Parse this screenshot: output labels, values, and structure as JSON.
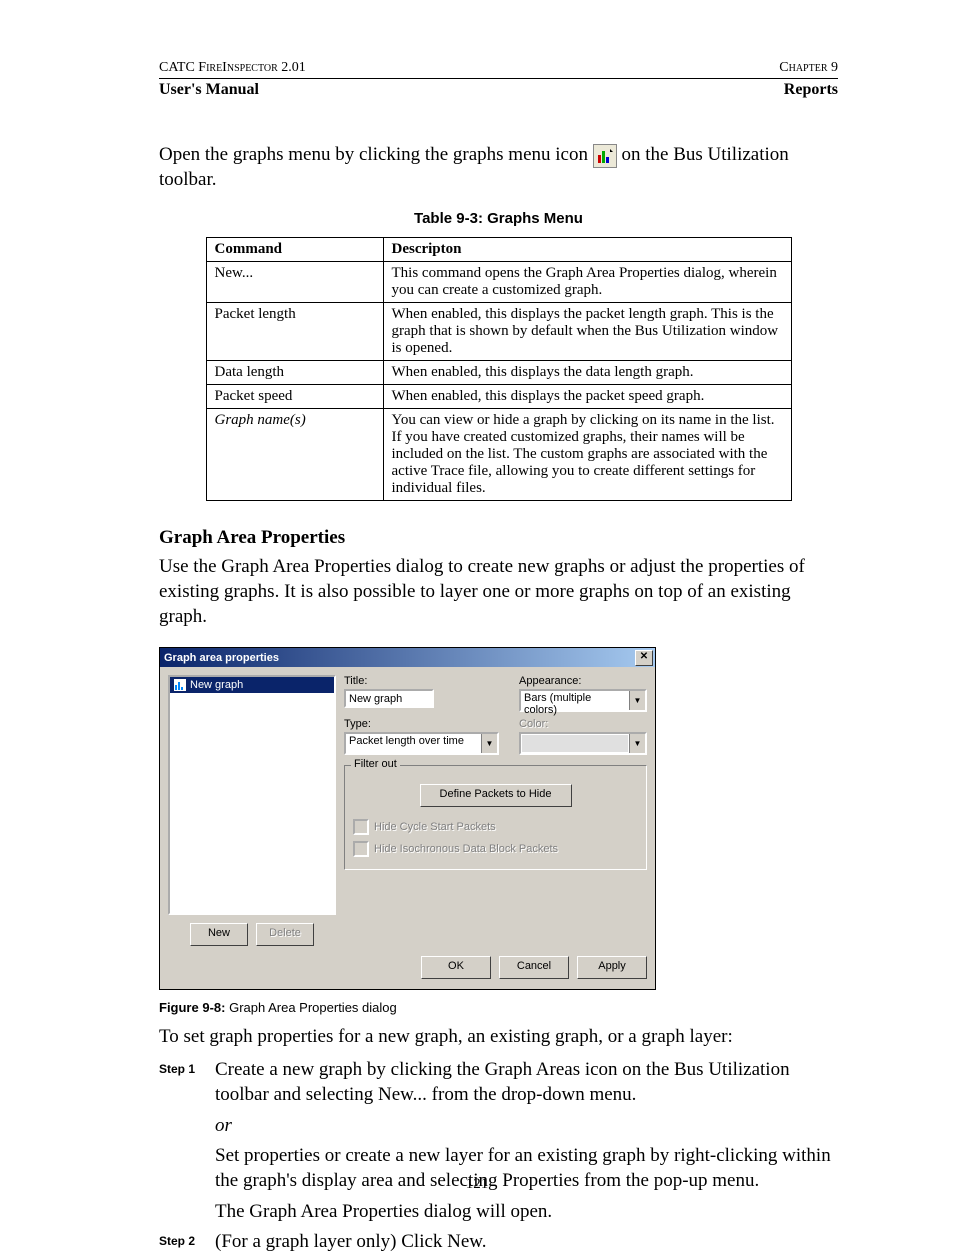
{
  "header": {
    "product": "CATC FireInspector 2.01",
    "chapter": "Chapter 9",
    "manual": "User's Manual",
    "section": "Reports"
  },
  "intro_a": "Open the graphs menu by clicking the graphs menu icon ",
  "intro_b": " on the Bus Utilization toolbar.",
  "table_caption": "Table 9-3: Graphs Menu",
  "table": {
    "headers": [
      "Command",
      "Descripton"
    ],
    "rows": [
      {
        "cmd": "New...",
        "desc": "This command opens the Graph Area Properties dialog, wherein you can create a customized graph."
      },
      {
        "cmd": "Packet length",
        "desc": "When enabled, this displays the packet length graph. This is the graph that is shown by default when the Bus Utilization window is opened."
      },
      {
        "cmd": "Data length",
        "desc": "When enabled, this displays the data length graph."
      },
      {
        "cmd": "Packet speed",
        "desc": "When enabled, this displays the packet speed graph."
      },
      {
        "cmd": "Graph name(s)",
        "italic": true,
        "desc": "You can view or hide a graph by clicking on its name in the list. If you have created customized graphs, their names will be included on the list. The custom graphs are associated with the active Trace file, allowing you to create different settings for individual files."
      }
    ]
  },
  "section_heading": "Graph Area Properties",
  "section_para": "Use the Graph Area Properties dialog to create new graphs or adjust the properties of existing graphs. It is also possible to layer one or more graphs on top of an existing graph.",
  "dialog": {
    "title": "Graph area properties",
    "list_item": "New graph",
    "btn_new": "New",
    "btn_delete": "Delete",
    "lbl_title": "Title:",
    "val_title": "New graph",
    "lbl_appearance": "Appearance:",
    "val_appearance": "Bars (multiple colors)",
    "lbl_type": "Type:",
    "val_type": "Packet length over time",
    "lbl_color": "Color:",
    "grp_filter": "Filter out",
    "btn_define": "Define Packets to Hide",
    "chk_cycle": "Hide Cycle Start Packets",
    "chk_iso": "Hide Isochronous Data Block Packets",
    "btn_ok": "OK",
    "btn_cancel": "Cancel",
    "btn_apply": "Apply"
  },
  "figure_caption_b": "Figure 9-8:",
  "figure_caption": "  Graph Area Properties dialog",
  "post_para": "To set graph properties for a new graph, an existing graph, or a graph layer:",
  "steps": {
    "s1_label": "Step 1",
    "s1_a": "Create a new graph by clicking the Graph Areas icon on the Bus Utilization toolbar and selecting New... from the drop-down menu.",
    "s1_or": "or",
    "s1_b": "Set properties or create a new layer for an existing graph by right-clicking within the graph's display area and selecting Properties from the pop-up menu.",
    "s1_c": "The Graph Area Properties dialog will open.",
    "s2_label": "Step 2",
    "s2_a": "(For a graph layer only) Click New."
  },
  "page_number": "121"
}
